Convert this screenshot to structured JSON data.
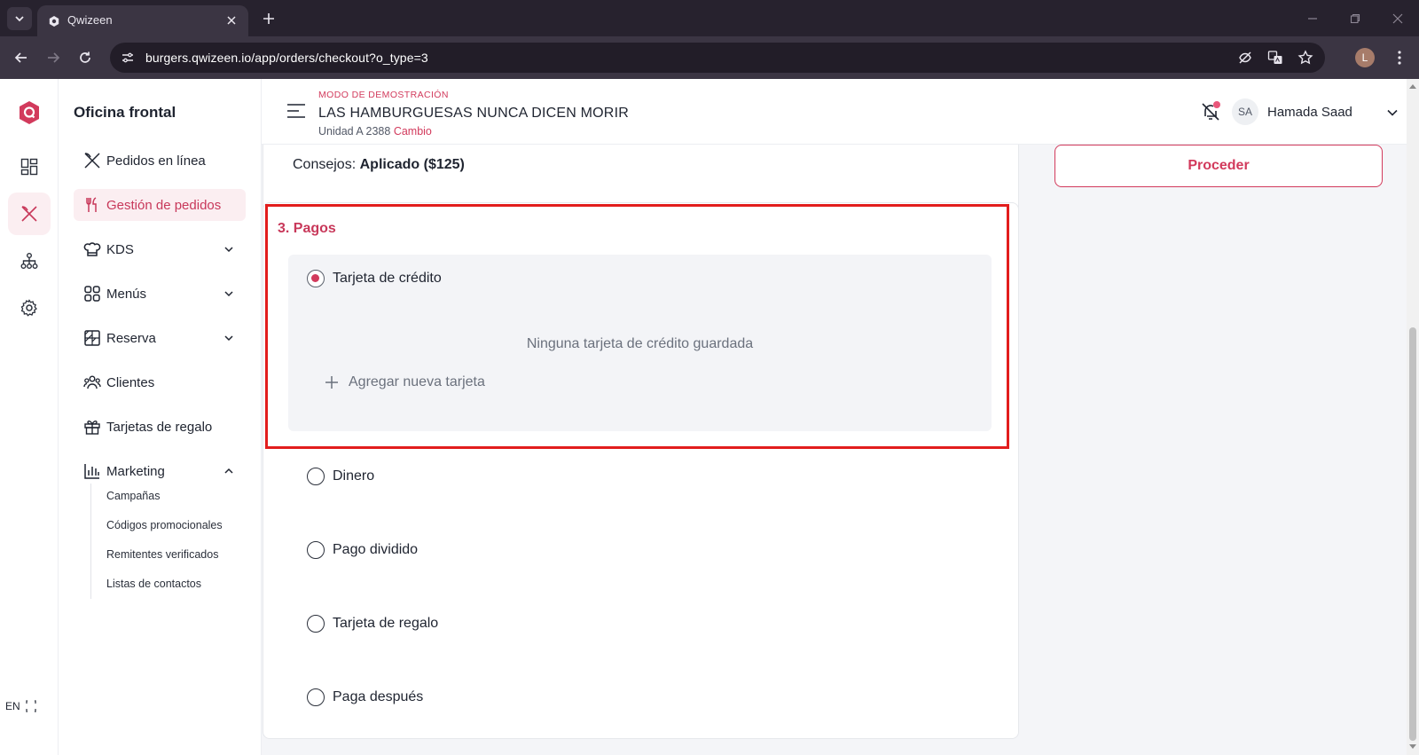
{
  "browser": {
    "tab_title": "Qwizeen",
    "url": "burgers.qwizeen.io/app/orders/checkout?o_type=3",
    "profile_initial": "L"
  },
  "rail": {
    "items": [
      "dashboard-icon",
      "orders-icon",
      "network-icon",
      "settings-icon"
    ],
    "language": "EN"
  },
  "sidebar": {
    "title": "Oficina frontal",
    "items": [
      {
        "label": "Pedidos en línea",
        "icon": "utensils-cross-icon"
      },
      {
        "label": "Gestión de pedidos",
        "icon": "fork-knife-icon",
        "active": true
      },
      {
        "label": "KDS",
        "icon": "chef-hat-icon"
      },
      {
        "label": "Menús",
        "icon": "grid-icon"
      },
      {
        "label": "Reserva",
        "icon": "table-icon"
      },
      {
        "label": "Clientes",
        "icon": "users-icon"
      },
      {
        "label": "Tarjetas de regalo",
        "icon": "gift-icon"
      },
      {
        "label": "Marketing",
        "icon": "chart-icon"
      }
    ],
    "marketing_sub": [
      "Campañas",
      "Códigos promocionales",
      "Remitentes verificados",
      "Listas de contactos"
    ]
  },
  "header": {
    "demo_label": "MODO DE DEMOSTRACIÓN",
    "store_name": "LAS HAMBURGUESAS NUNCA DICEN MORIR",
    "store_unit": "Unidad A 2388",
    "change_link": "Cambio",
    "user_initials": "SA",
    "user_name": "Hamada Saad"
  },
  "summary": {
    "tips_label": "Consejos:",
    "tips_value": "Aplicado ($125)"
  },
  "payments": {
    "title": "3. Pagos",
    "options": [
      "Tarjeta de crédito",
      "Dinero",
      "Pago dividido",
      "Tarjeta de regalo",
      "Paga después"
    ],
    "selected": "Tarjeta de crédito",
    "no_cards_text": "Ninguna tarjeta de crédito guardada",
    "add_card_label": "Agregar nueva tarjeta"
  },
  "actions": {
    "proceed_label": "Proceder"
  },
  "colors": {
    "accent": "#d23a5c",
    "highlight": "#e21d1d"
  }
}
